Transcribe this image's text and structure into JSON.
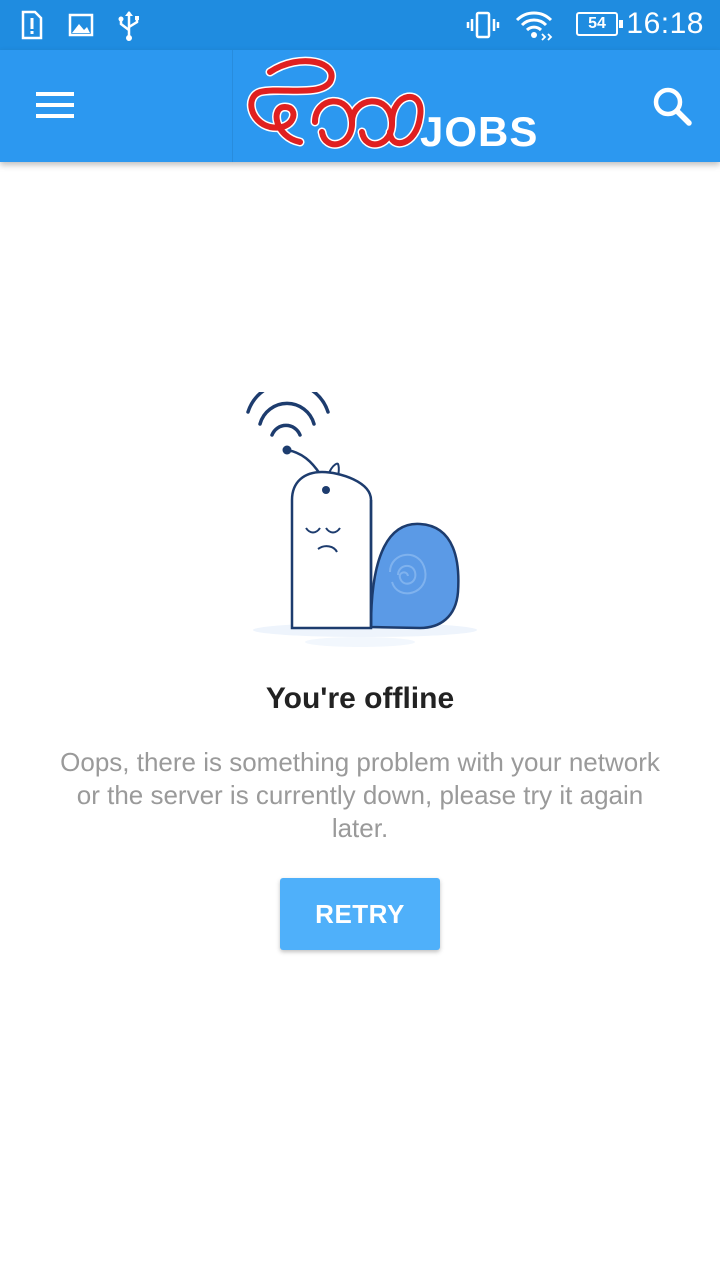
{
  "status_bar": {
    "icons": [
      "sim-alert-icon",
      "image-icon",
      "usb-icon",
      "vibrate-icon",
      "wifi-icon",
      "battery-icon"
    ],
    "battery_level": "54",
    "time": "16:18"
  },
  "app_bar": {
    "menu_icon": "hamburger-menu-icon",
    "logo_jobs_text": "JOBS",
    "search_icon": "search-icon",
    "colors": {
      "background": "#2c98f0",
      "logo_red": "#e02020"
    }
  },
  "offline": {
    "illustration": "offline-snail-icon",
    "title": "You're offline",
    "message": "Oops, there is something problem with your network or the server is currently down, please try it again later.",
    "retry_label": "RETRY",
    "colors": {
      "button": "#4fb0fa",
      "message": "#9a9a9a"
    }
  }
}
